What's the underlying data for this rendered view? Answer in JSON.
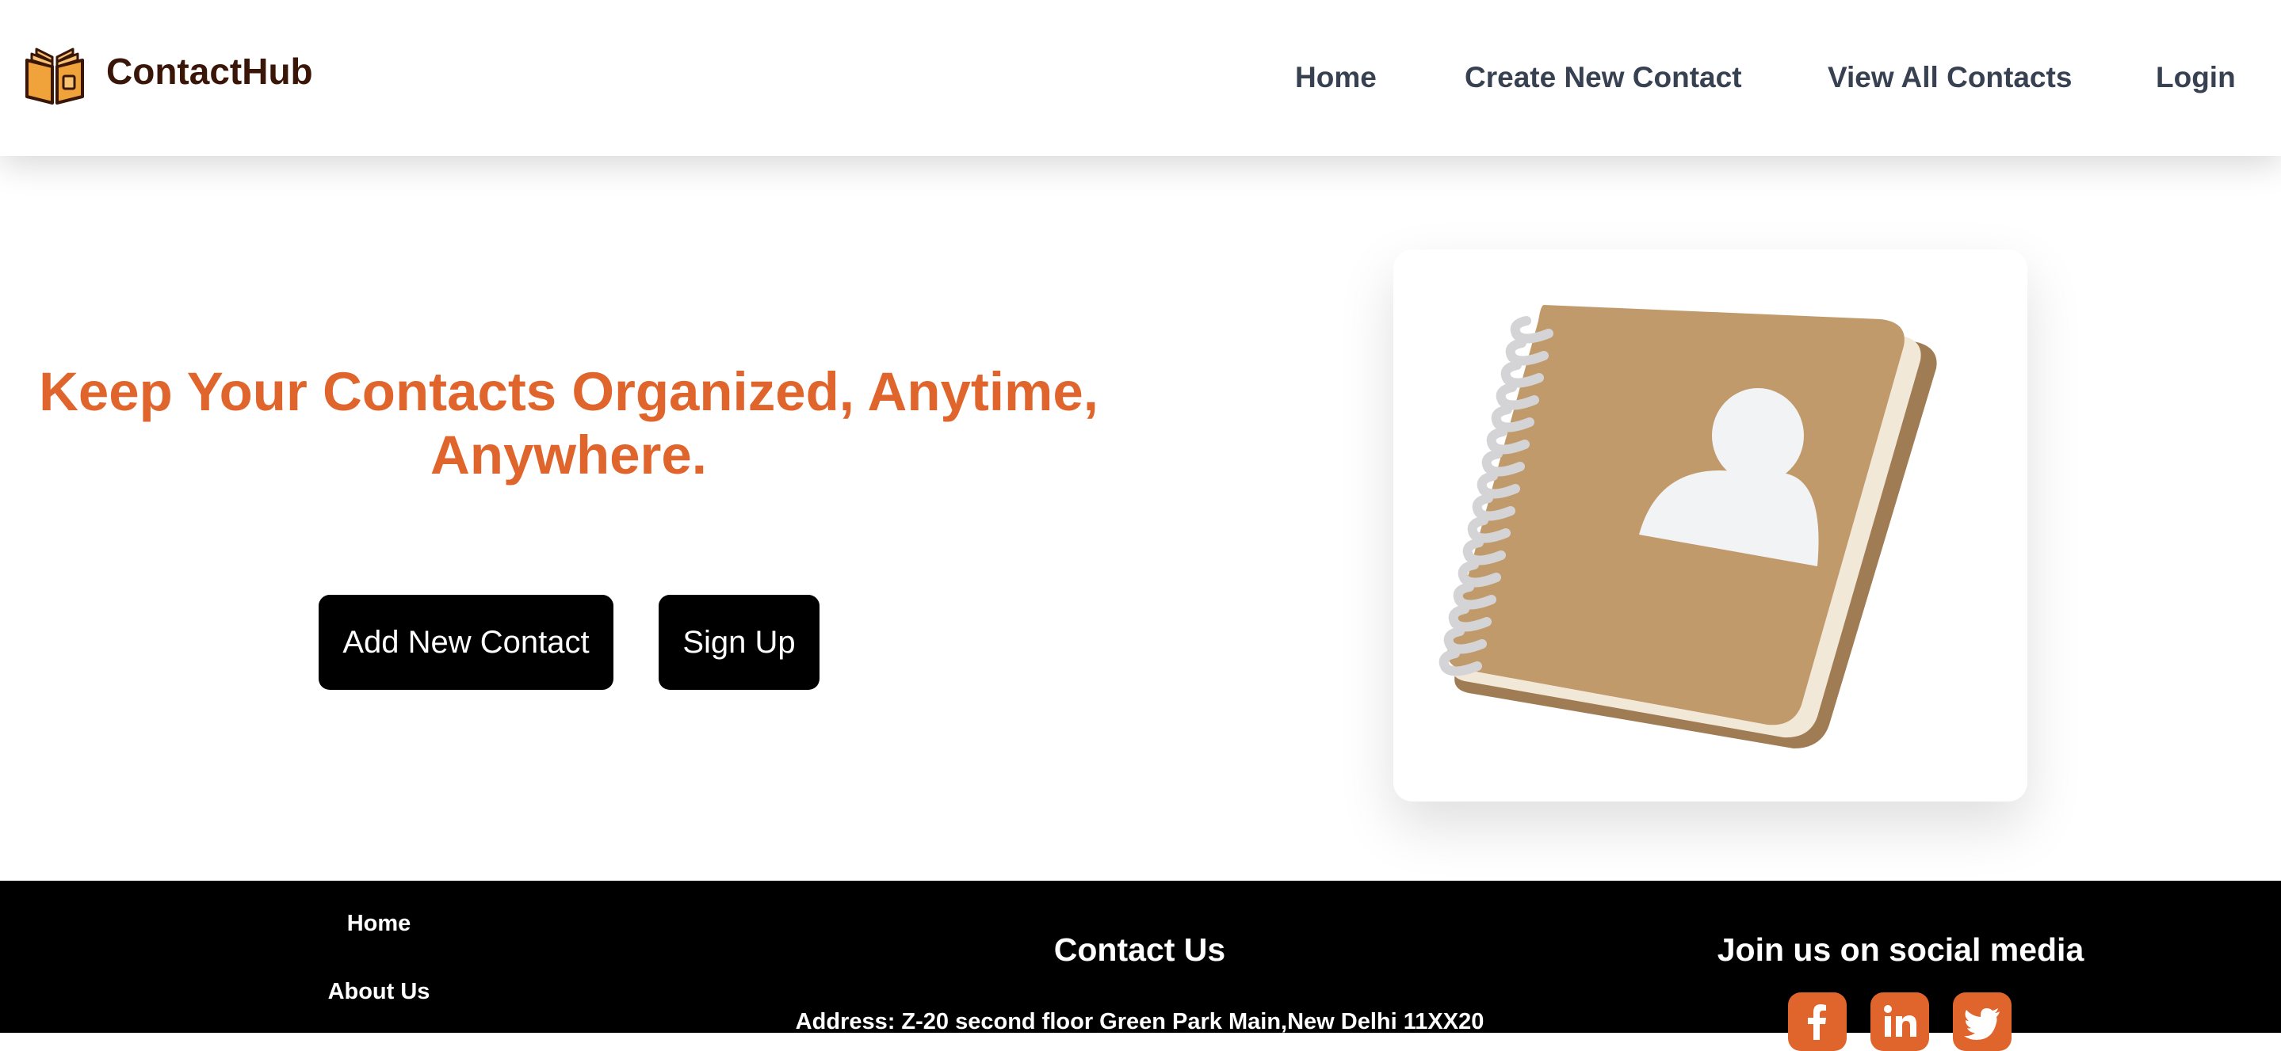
{
  "header": {
    "brand": "ContactHub",
    "logo_icon": "open-book-icon",
    "nav": {
      "home": "Home",
      "create": "Create New Contact",
      "view_all": "View All Contacts",
      "login": "Login"
    }
  },
  "hero": {
    "title_line1": "Keep Your Contacts Organized, Anytime,",
    "title_line2": "Anywhere.",
    "add_button": "Add New Contact",
    "signup_button": "Sign Up",
    "illustration_icon": "address-book-icon"
  },
  "footer": {
    "links": {
      "home": "Home",
      "about": "About Us"
    },
    "contact_title": "Contact Us",
    "address": "Address: Z-20 second floor Green Park Main,New Delhi 11XX20",
    "social_title": "Join us on social media",
    "social_icons": [
      "facebook-icon",
      "linkedin-icon",
      "twitter-icon"
    ]
  },
  "colors": {
    "accent": "#e0652c",
    "brand_text": "#3a1608",
    "nav_text": "#374151",
    "button_bg": "#000000",
    "footer_bg": "#000000",
    "book_cover": "#c19a6b"
  }
}
